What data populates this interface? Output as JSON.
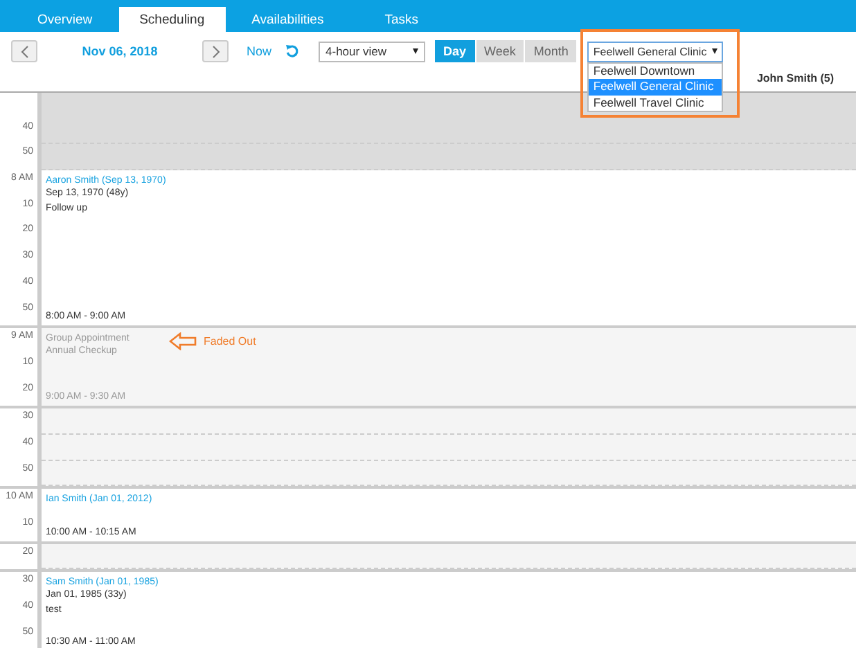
{
  "tabs": [
    {
      "label": "Overview",
      "selected": false
    },
    {
      "label": "Scheduling",
      "selected": true
    },
    {
      "label": "Availabilities",
      "selected": false
    },
    {
      "label": "Tasks",
      "selected": false
    }
  ],
  "toolbar": {
    "date": "Nov 06, 2018",
    "now": "Now",
    "view_select": {
      "value": "4-hour view"
    },
    "views": [
      {
        "label": "Day",
        "selected": true
      },
      {
        "label": "Week",
        "selected": false
      },
      {
        "label": "Month",
        "selected": false
      }
    ],
    "location_select": {
      "value": "Feelwell General Clinic",
      "expanded": true,
      "options": [
        {
          "label": "Feelwell Downtown",
          "selected": false
        },
        {
          "label": "Feelwell General Clinic",
          "selected": true
        },
        {
          "label": "Feelwell Travel Clinic",
          "selected": false
        }
      ]
    }
  },
  "provider": "John Smith (5)",
  "blocks": [
    {
      "kind": "unavailable",
      "labels": [
        "40",
        "50"
      ]
    },
    {
      "kind": "appointment",
      "labels": [
        "8 AM",
        "10",
        "20",
        "30",
        "40",
        "50"
      ],
      "name": "Aaron Smith (Sep 13, 1970)",
      "details": [
        "Sep 13, 1970 (48y)",
        "Follow up"
      ],
      "time": "8:00 AM - 9:00 AM"
    },
    {
      "kind": "faded",
      "labels": [
        "9 AM",
        "10",
        "20"
      ],
      "name": "Group Appointment",
      "details": [
        "Annual Checkup"
      ],
      "time": "9:00 AM - 9:30 AM",
      "annotation": "Faded Out"
    },
    {
      "kind": "open",
      "labels": [
        "30",
        "40",
        "50"
      ]
    },
    {
      "kind": "appointment",
      "labels": [
        "10 AM",
        "10"
      ],
      "name": "Ian Smith (Jan 01, 2012)",
      "time": "10:00 AM - 10:15 AM"
    },
    {
      "kind": "open",
      "labels": [
        "20"
      ]
    },
    {
      "kind": "appointment",
      "labels": [
        "30",
        "40",
        "50"
      ],
      "name": "Sam Smith (Jan 01, 1985)",
      "details": [
        "Jan 01, 1985 (33y)",
        "test"
      ],
      "time": "10:30 AM - 11:00 AM"
    }
  ]
}
